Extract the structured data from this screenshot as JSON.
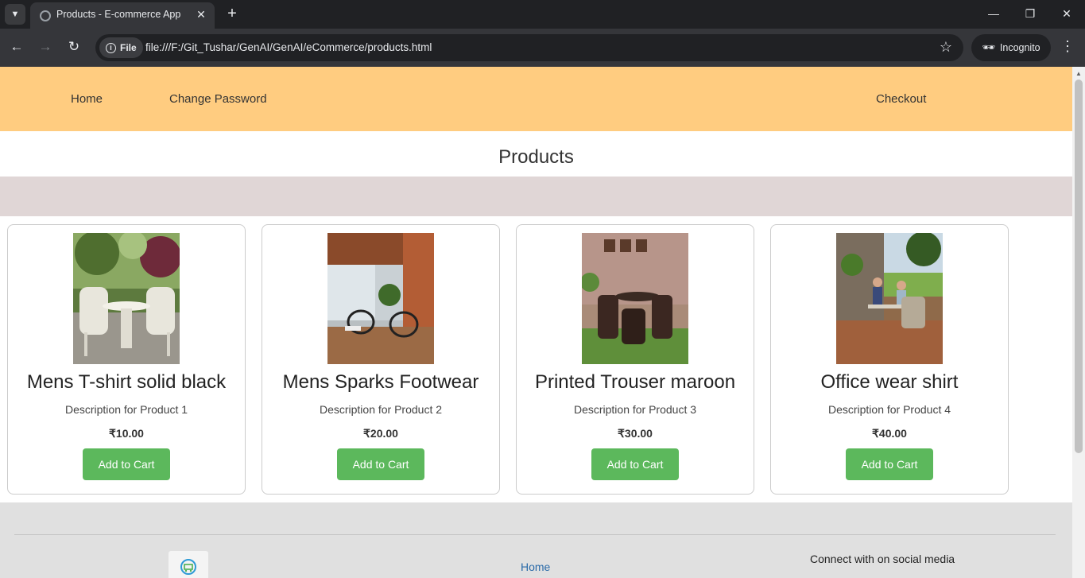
{
  "browser": {
    "tab_title": "Products - E-commerce App",
    "site_chip_label": "File",
    "url": "file:///F:/Git_Tushar/GenAI/GenAI/eCommerce/products.html",
    "incognito_label": "Incognito"
  },
  "nav": {
    "home": "Home",
    "change_password": "Change Password",
    "checkout": "Checkout"
  },
  "page": {
    "title": "Products"
  },
  "products": [
    {
      "name": "Mens T-shirt solid black",
      "description": "Description for Product 1",
      "price": "₹10.00",
      "button": "Add to Cart"
    },
    {
      "name": "Mens Sparks Footwear",
      "description": "Description for Product 2",
      "price": "₹20.00",
      "button": "Add to Cart"
    },
    {
      "name": "Printed Trouser maroon",
      "description": "Description for Product 3",
      "price": "₹30.00",
      "button": "Add to Cart"
    },
    {
      "name": "Office wear shirt",
      "description": "Description for Product 4",
      "price": "₹40.00",
      "button": "Add to Cart"
    }
  ],
  "footer": {
    "home_link": "Home",
    "social_text": "Connect with on social media"
  },
  "colors": {
    "nav_bg": "#ffcc80",
    "band_bg": "#e0d6d6",
    "button_green": "#5cb85c",
    "footer_bg": "#e0e0e0"
  }
}
